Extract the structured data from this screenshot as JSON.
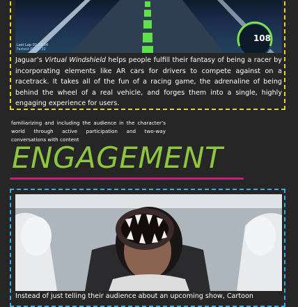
{
  "jaguar_section": {
    "image": {
      "last_lap": "Last Lap 02:12:34",
      "fastest": "Fastest 02:09:32",
      "speed": "108"
    },
    "text_before": "Jaguar’s ",
    "text_italic": "Virtual Windshield",
    "text_after": " helps people fulfill their fantasy of being a racer by incorporating elements like AR cars for drivers to compete against on a racetrack. It takes all of the fun of a racing game, the adrenaline of being behind the wheel of a real vehicle, and forges them into a single, highly engaging experience for users."
  },
  "engagement": {
    "description": "familiarizing and including the audience in the character’s world through active participation and two-way conversations with content",
    "title": "ENGAGEMENT"
  },
  "cartoon_section": {
    "text": "Instead of just telling their audience about an upcoming show, Cartoon"
  },
  "colors": {
    "background": "#262626",
    "top_border": "#e6d23a",
    "bottom_border": "#3fa9e0",
    "title_green": "#8dc63f",
    "underline_magenta": "#c2227a"
  }
}
